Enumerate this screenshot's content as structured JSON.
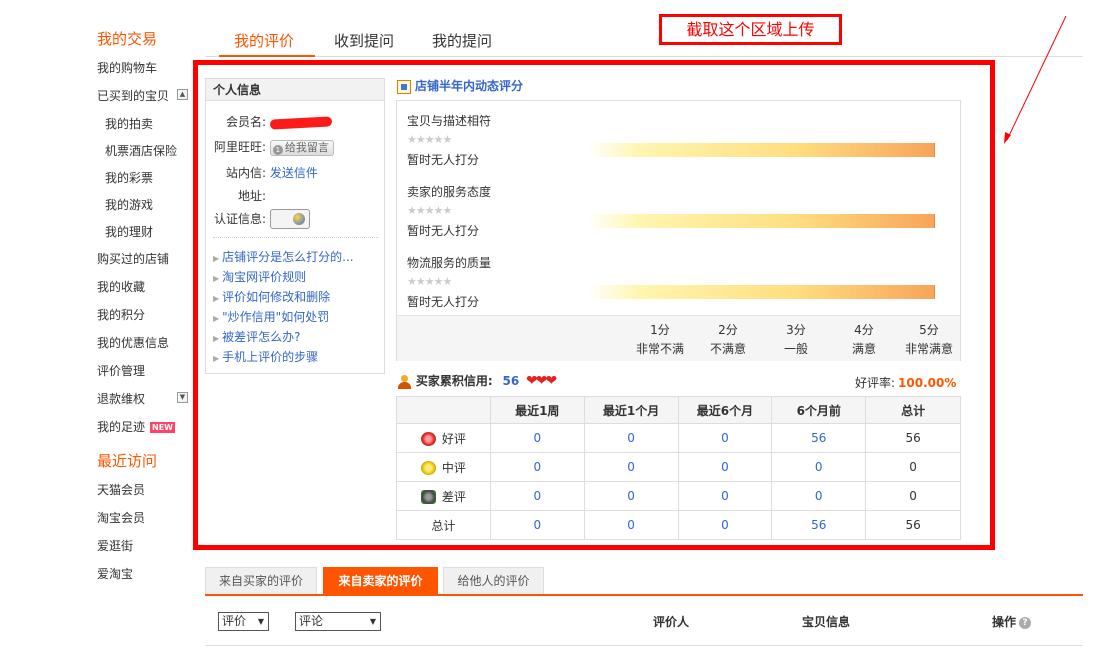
{
  "sidebar": {
    "section1": "我的交易",
    "items": [
      "我的购物车",
      "已买到的宝贝",
      "我的拍卖",
      "机票酒店保险",
      "我的彩票",
      "我的游戏",
      "我的理财",
      "购买过的店铺",
      "我的收藏",
      "我的积分",
      "我的优惠信息",
      "评价管理",
      "退款维权",
      "我的足迹"
    ],
    "new_badge": "NEW",
    "section2": "最近访问",
    "recent": [
      "天猫会员",
      "淘宝会员",
      "爱逛街",
      "爱淘宝"
    ],
    "collapse_glyph": "▲",
    "expand_glyph": "▼"
  },
  "top_tabs": [
    "我的评价",
    "收到提问",
    "我的提问"
  ],
  "annotation": "截取这个区域上传",
  "info": {
    "title": "个人信息",
    "member_label": "会员名:",
    "wangwang_label": "阿里旺旺:",
    "wangwang_button": "给我留言",
    "message_label": "站内信:",
    "message_link": "发送信件",
    "address_label": "地址:",
    "cert_label": "认证信息:",
    "faq": [
      "店铺评分是怎么打分的...",
      "淘宝网评价规则",
      "评价如何修改和删除",
      "\"炒作信用\"如何处罚",
      "被差评怎么办?",
      "手机上评价的步骤"
    ]
  },
  "rating": {
    "title": "店铺半年内动态评分",
    "items": [
      {
        "name": "宝贝与描述相符",
        "status": "暂时无人打分"
      },
      {
        "name": "卖家的服务态度",
        "status": "暂时无人打分"
      },
      {
        "name": "物流服务的质量",
        "status": "暂时无人打分"
      }
    ],
    "stars": "★★★★★",
    "scale": [
      {
        "score": "1分",
        "label": "非常不满"
      },
      {
        "score": "2分",
        "label": "不满意"
      },
      {
        "score": "3分",
        "label": "一般"
      },
      {
        "score": "4分",
        "label": "满意"
      },
      {
        "score": "5分",
        "label": "非常满意"
      }
    ]
  },
  "credit": {
    "label": "买家累积信用:",
    "value": "56",
    "hearts": "❤❤❤",
    "good_rate_label": "好评率:",
    "good_rate_value": "100.00%"
  },
  "table": {
    "headers": [
      "",
      "最近1周",
      "最近1个月",
      "最近6个月",
      "6个月前",
      "总计"
    ],
    "rows": [
      {
        "label": "好评",
        "values": [
          "0",
          "0",
          "0",
          "56",
          "56"
        ]
      },
      {
        "label": "中评",
        "values": [
          "0",
          "0",
          "0",
          "0",
          "0"
        ]
      },
      {
        "label": "差评",
        "values": [
          "0",
          "0",
          "0",
          "0",
          "0"
        ]
      },
      {
        "label": "总计",
        "values": [
          "0",
          "0",
          "0",
          "56",
          "56"
        ]
      }
    ]
  },
  "bottom_tabs": [
    "来自买家的评价",
    "来自卖家的评价",
    "给他人的评价"
  ],
  "filters": {
    "select1": "评价",
    "select2": "评论",
    "caret": "▼"
  },
  "list_headers": {
    "rater": "评价人",
    "item_info": "宝贝信息",
    "action": "操作",
    "help": "?"
  },
  "colors": {
    "accent": "#ff5500",
    "link": "#3366cc",
    "annotation": "#ff0000"
  }
}
